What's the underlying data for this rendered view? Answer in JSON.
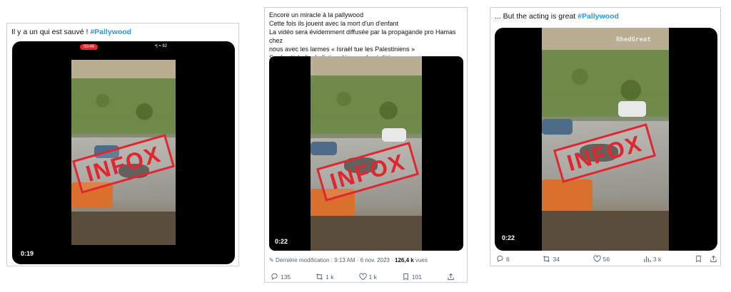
{
  "tweets": [
    {
      "text": "Il y a un qui est sauvé !",
      "hashtag": "#Pallywood",
      "stamp": "INFOX",
      "time": "0:19",
      "status_rec": "00:46",
      "status_signal": "•| ≈ 82"
    },
    {
      "lines": [
        "Encore un miracle à la pallywood",
        "Cette fois ils jouent avec la mort d'un d'enfant",
        "La vidéo sera évidemment diffusée par la propagande pro Hamas chez",
        "nous avec les larmes « Israël tue les Palestiniens »",
        "Sauf qu'à la fin, la fiction dépasse la réalité"
      ],
      "stamp": "INFOX",
      "time": "0:22",
      "meta_prefix": "Dernière modification : 9:13 AM · 6 nov. 2023 ·",
      "views": "126,4 k",
      "views_suffix": "vues",
      "actions": {
        "replies": "135",
        "reposts": "1 k",
        "likes": "1 k",
        "bookmarks": "101"
      }
    },
    {
      "text": "... But the acting is great",
      "hashtag": "#Pallywood",
      "stamp": "INFOX",
      "time": "0:22",
      "watermark": "RhedGreat",
      "actions": {
        "replies": "6",
        "reposts": "34",
        "likes": "56",
        "views": "3 k"
      }
    }
  ],
  "colors": {
    "accent": "#1d9bf0",
    "stamp": "#e0262f",
    "muted": "#536471"
  }
}
